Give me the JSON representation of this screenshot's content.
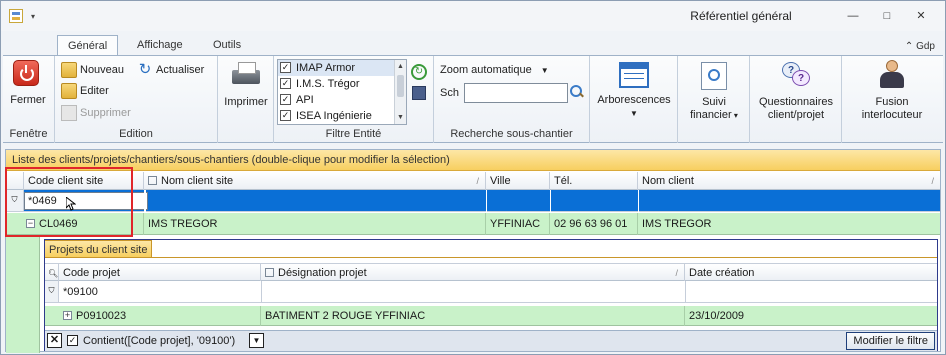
{
  "window": {
    "title": "Référentiel général",
    "controls": {
      "minimize": "—",
      "maximize": "□",
      "close": "✕"
    },
    "quick_access": "▾"
  },
  "tabs": [
    {
      "label": "Général",
      "active": true
    },
    {
      "label": "Affichage",
      "active": false
    },
    {
      "label": "Outils",
      "active": false
    }
  ],
  "help": "Gdp",
  "ribbon": {
    "fenetre": {
      "close_label": "Fermer",
      "group": "Fenêtre"
    },
    "edition": {
      "group": "Edition",
      "nouveau": "Nouveau",
      "actualiser": "Actualiser",
      "editer": "Editer",
      "supprimer": "Supprimer"
    },
    "imprimer": {
      "label": "Imprimer"
    },
    "filtre": {
      "group": "Filtre Entité",
      "items": [
        {
          "label": "IMAP Armor",
          "checked": true
        },
        {
          "label": "I.M.S. Trégor",
          "checked": true
        },
        {
          "label": "API",
          "checked": true
        },
        {
          "label": "ISEA Ingénierie",
          "checked": true
        }
      ]
    },
    "recherche": {
      "group": "Recherche sous-chantier",
      "zoom": "Zoom automatique",
      "sch_label": "Sch",
      "sch_value": ""
    },
    "arborescences": "Arborescences",
    "suivi": {
      "line1": "Suivi",
      "line2": "financier"
    },
    "questionnaires": {
      "line1": "Questionnaires",
      "line2": "client/projet"
    },
    "fusion": {
      "line1": "Fusion",
      "line2": "interlocuteur"
    }
  },
  "grid": {
    "caption": "Liste des clients/projets/chantiers/sous-chantiers (double-clique pour modifier la sélection)",
    "columns": [
      "Code client site",
      "Nom client site",
      "Ville",
      "Tél.",
      "Nom client"
    ],
    "filter_value": "*0469",
    "rows": [
      {
        "code": "CL0469",
        "nom": "IMS TREGOR",
        "ville": "YFFINIAC",
        "tel": "02 96 63 96 01",
        "client": "IMS TREGOR"
      }
    ]
  },
  "detail": {
    "tab": "Projets du client site",
    "columns": [
      "Code projet",
      "Désignation projet",
      "Date création"
    ],
    "filter_value": "*09100",
    "rows": [
      {
        "code": "P0910023",
        "designation": "BATIMENT 2 ROUGE YFFINIAC",
        "date": "23/10/2009"
      }
    ],
    "filter_expression": "Contient([Code projet], '09100')",
    "modify_label": "Modifier le filtre"
  }
}
